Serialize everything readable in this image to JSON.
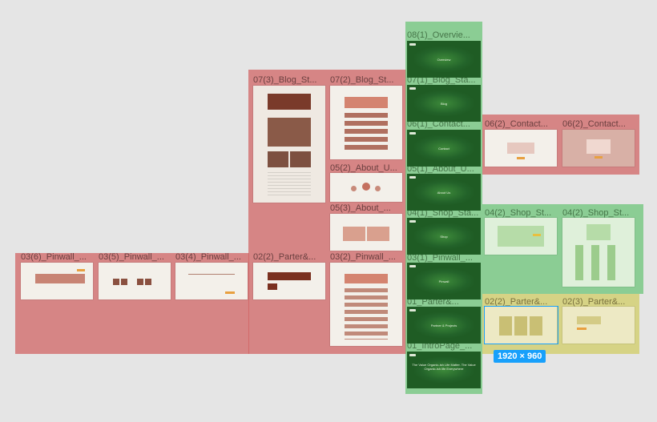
{
  "canvas": {
    "background": "#e5e5e5",
    "colors": {
      "red_region": "#d06060",
      "green_region": "#6cc478",
      "yellow_region": "#d0cc64",
      "selection": "#18a0fb"
    }
  },
  "frames": {
    "f08_1": "08(1)_Overvie...",
    "f07_1": "07(1)_Blog_Sta...",
    "f06_1": "06(1)_Contact...",
    "f05_1": "05(1)_About_U...",
    "f04_1": "04(1)_Shop_Sta...",
    "f03_1": "03(1)_Pinwall_...",
    "f01_2": "01_Parter&...",
    "f01": "01_IntroPage_...",
    "f07_3": "07(3)_Blog_St...",
    "f07_2": "07(2)_Blog_St...",
    "f05_2": "05(2)_About_U...",
    "f05_3": "05(3)_About_...",
    "f03_6": "03(6)_Pinwall_...",
    "f03_5": "03(5)_Pinwall_...",
    "f03_4": "03(4)_Pinwall_...",
    "f02_2r": "02(2)_Parter&...",
    "f03_2": "03(2)_Pinwall_...",
    "f06_2": "06(2)_Contact...",
    "f06_3": "06(2)_Contact...",
    "f04_2": "04(2)_Shop_St...",
    "f04_3": "04(2)_Shop_St...",
    "f02_2": "02(2)_Parter&...",
    "f02_3": "02(3)_Parter&..."
  },
  "thumbs": {
    "overview": "Overview",
    "blog": "Blog",
    "contact": "Contact",
    "about": "About Us",
    "shop": "Shop",
    "pinwall": "Pinwall",
    "partners": "Partner & Projects",
    "intro": "The Value Organic-ish Life Matter. The Value Organic-ish life Everywhere"
  },
  "selection": {
    "size_badge": "1920 × 960"
  }
}
